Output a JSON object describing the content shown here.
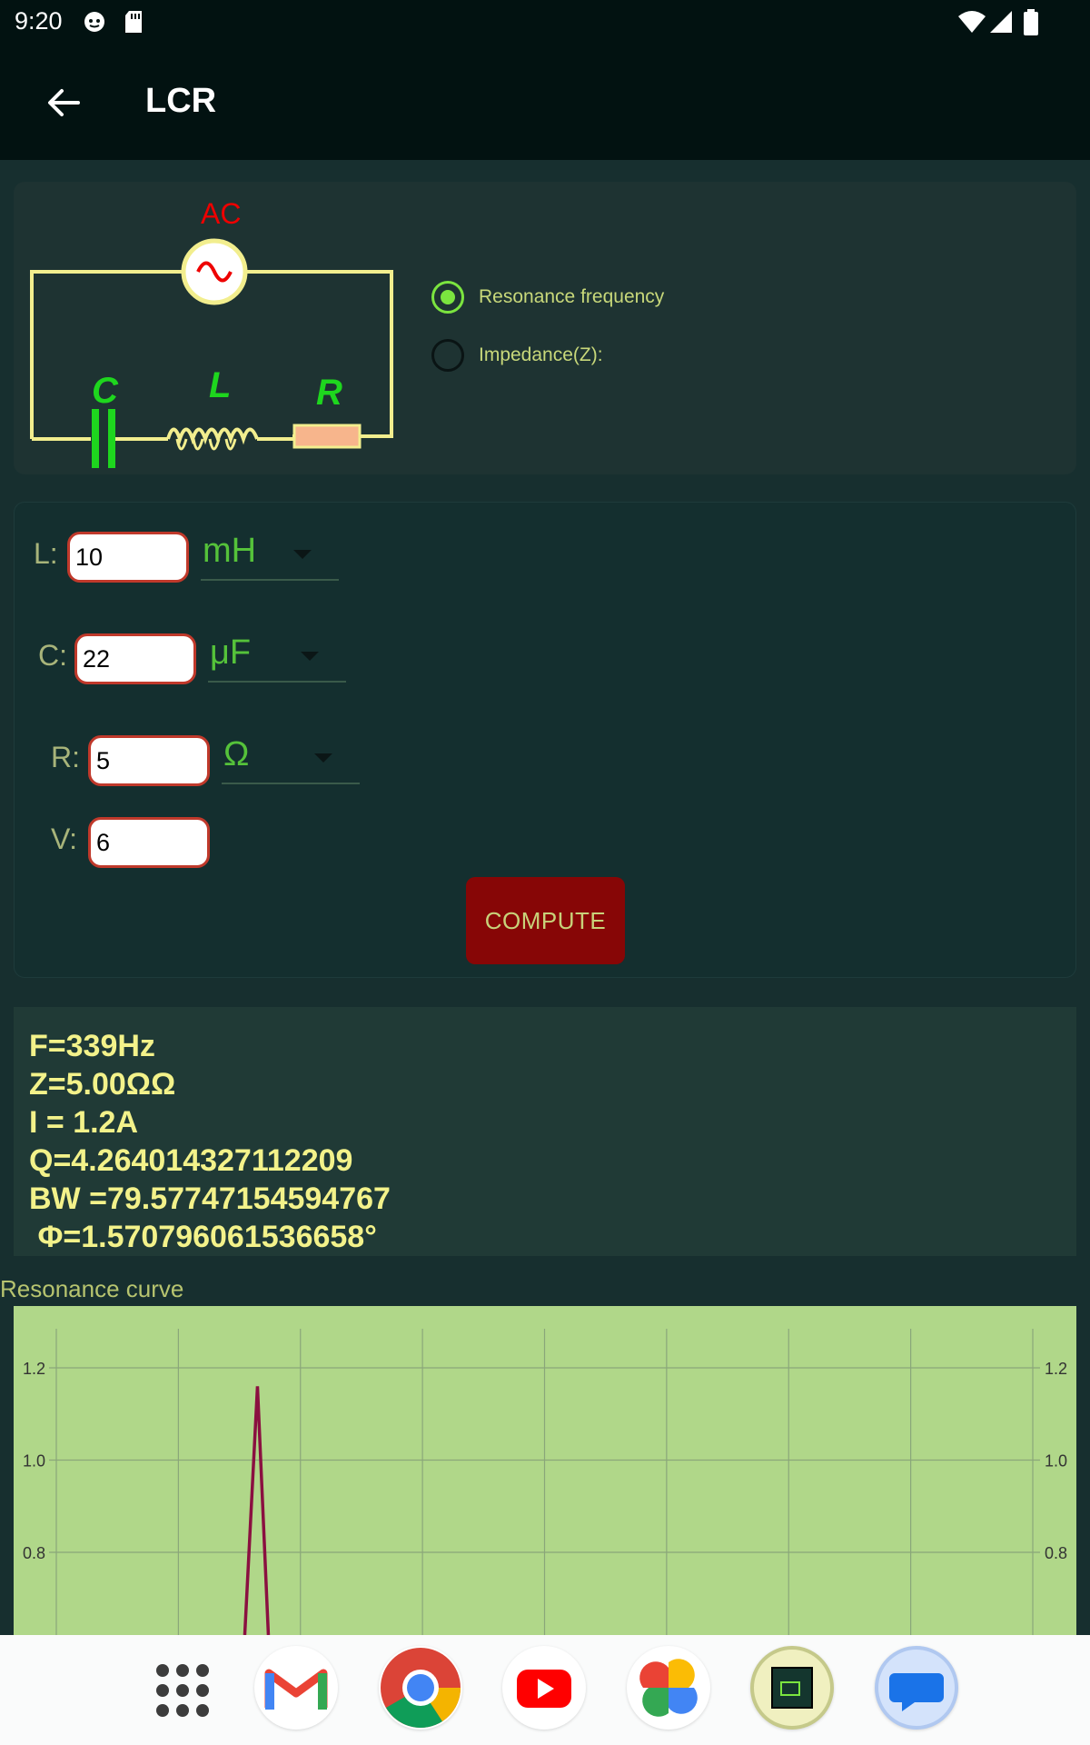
{
  "status_bar": {
    "time": "9:20"
  },
  "app_bar": {
    "title": "LCR"
  },
  "circuit": {
    "source_label": "AC",
    "c_label": "C",
    "l_label": "L",
    "r_label": "R"
  },
  "mode_options": [
    {
      "label": "Resonance frequency",
      "selected": true
    },
    {
      "label": "Impedance(Z):",
      "selected": false
    }
  ],
  "inputs": {
    "L": {
      "label": "L:",
      "value": "10",
      "unit": "mH"
    },
    "C": {
      "label": "C:",
      "value": "22",
      "unit": "μF"
    },
    "R": {
      "label": "R:",
      "value": "5",
      "unit": "Ω"
    },
    "V": {
      "label": "V:",
      "value": "6"
    }
  },
  "compute_label": "COMPUTE",
  "results": [
    "F=339Hz",
    "Z=5.00ΩΩ",
    "I = 1.2A",
    "Q=4.264014327112209",
    "BW =79.57747154594767",
    " Φ=1.570796061536658°"
  ],
  "chart_title": "Resonance curve",
  "chart_data": {
    "type": "line",
    "title": "Resonance curve",
    "xlabel": "",
    "ylabel": "",
    "ylim_visible": [
      0.8,
      1.2
    ],
    "y_ticks": [
      "1.2",
      "1.0",
      "0.8"
    ],
    "grid": true,
    "series": [
      {
        "color": "#8a1040",
        "peak_x_fraction": 0.206,
        "peak_y": 1.16
      }
    ]
  },
  "colors": {
    "background": "#172f2f",
    "app_bar": "#021211",
    "accent_green": "#7be43f",
    "result_text": "#f3f28a",
    "compute_button": "#870606",
    "chart_bg": "#b0d789"
  },
  "dock_apps": [
    "app-drawer-icon",
    "gmail-icon",
    "chrome-icon",
    "youtube-icon",
    "photos-icon",
    "lcr-app-icon",
    "messages-icon"
  ]
}
